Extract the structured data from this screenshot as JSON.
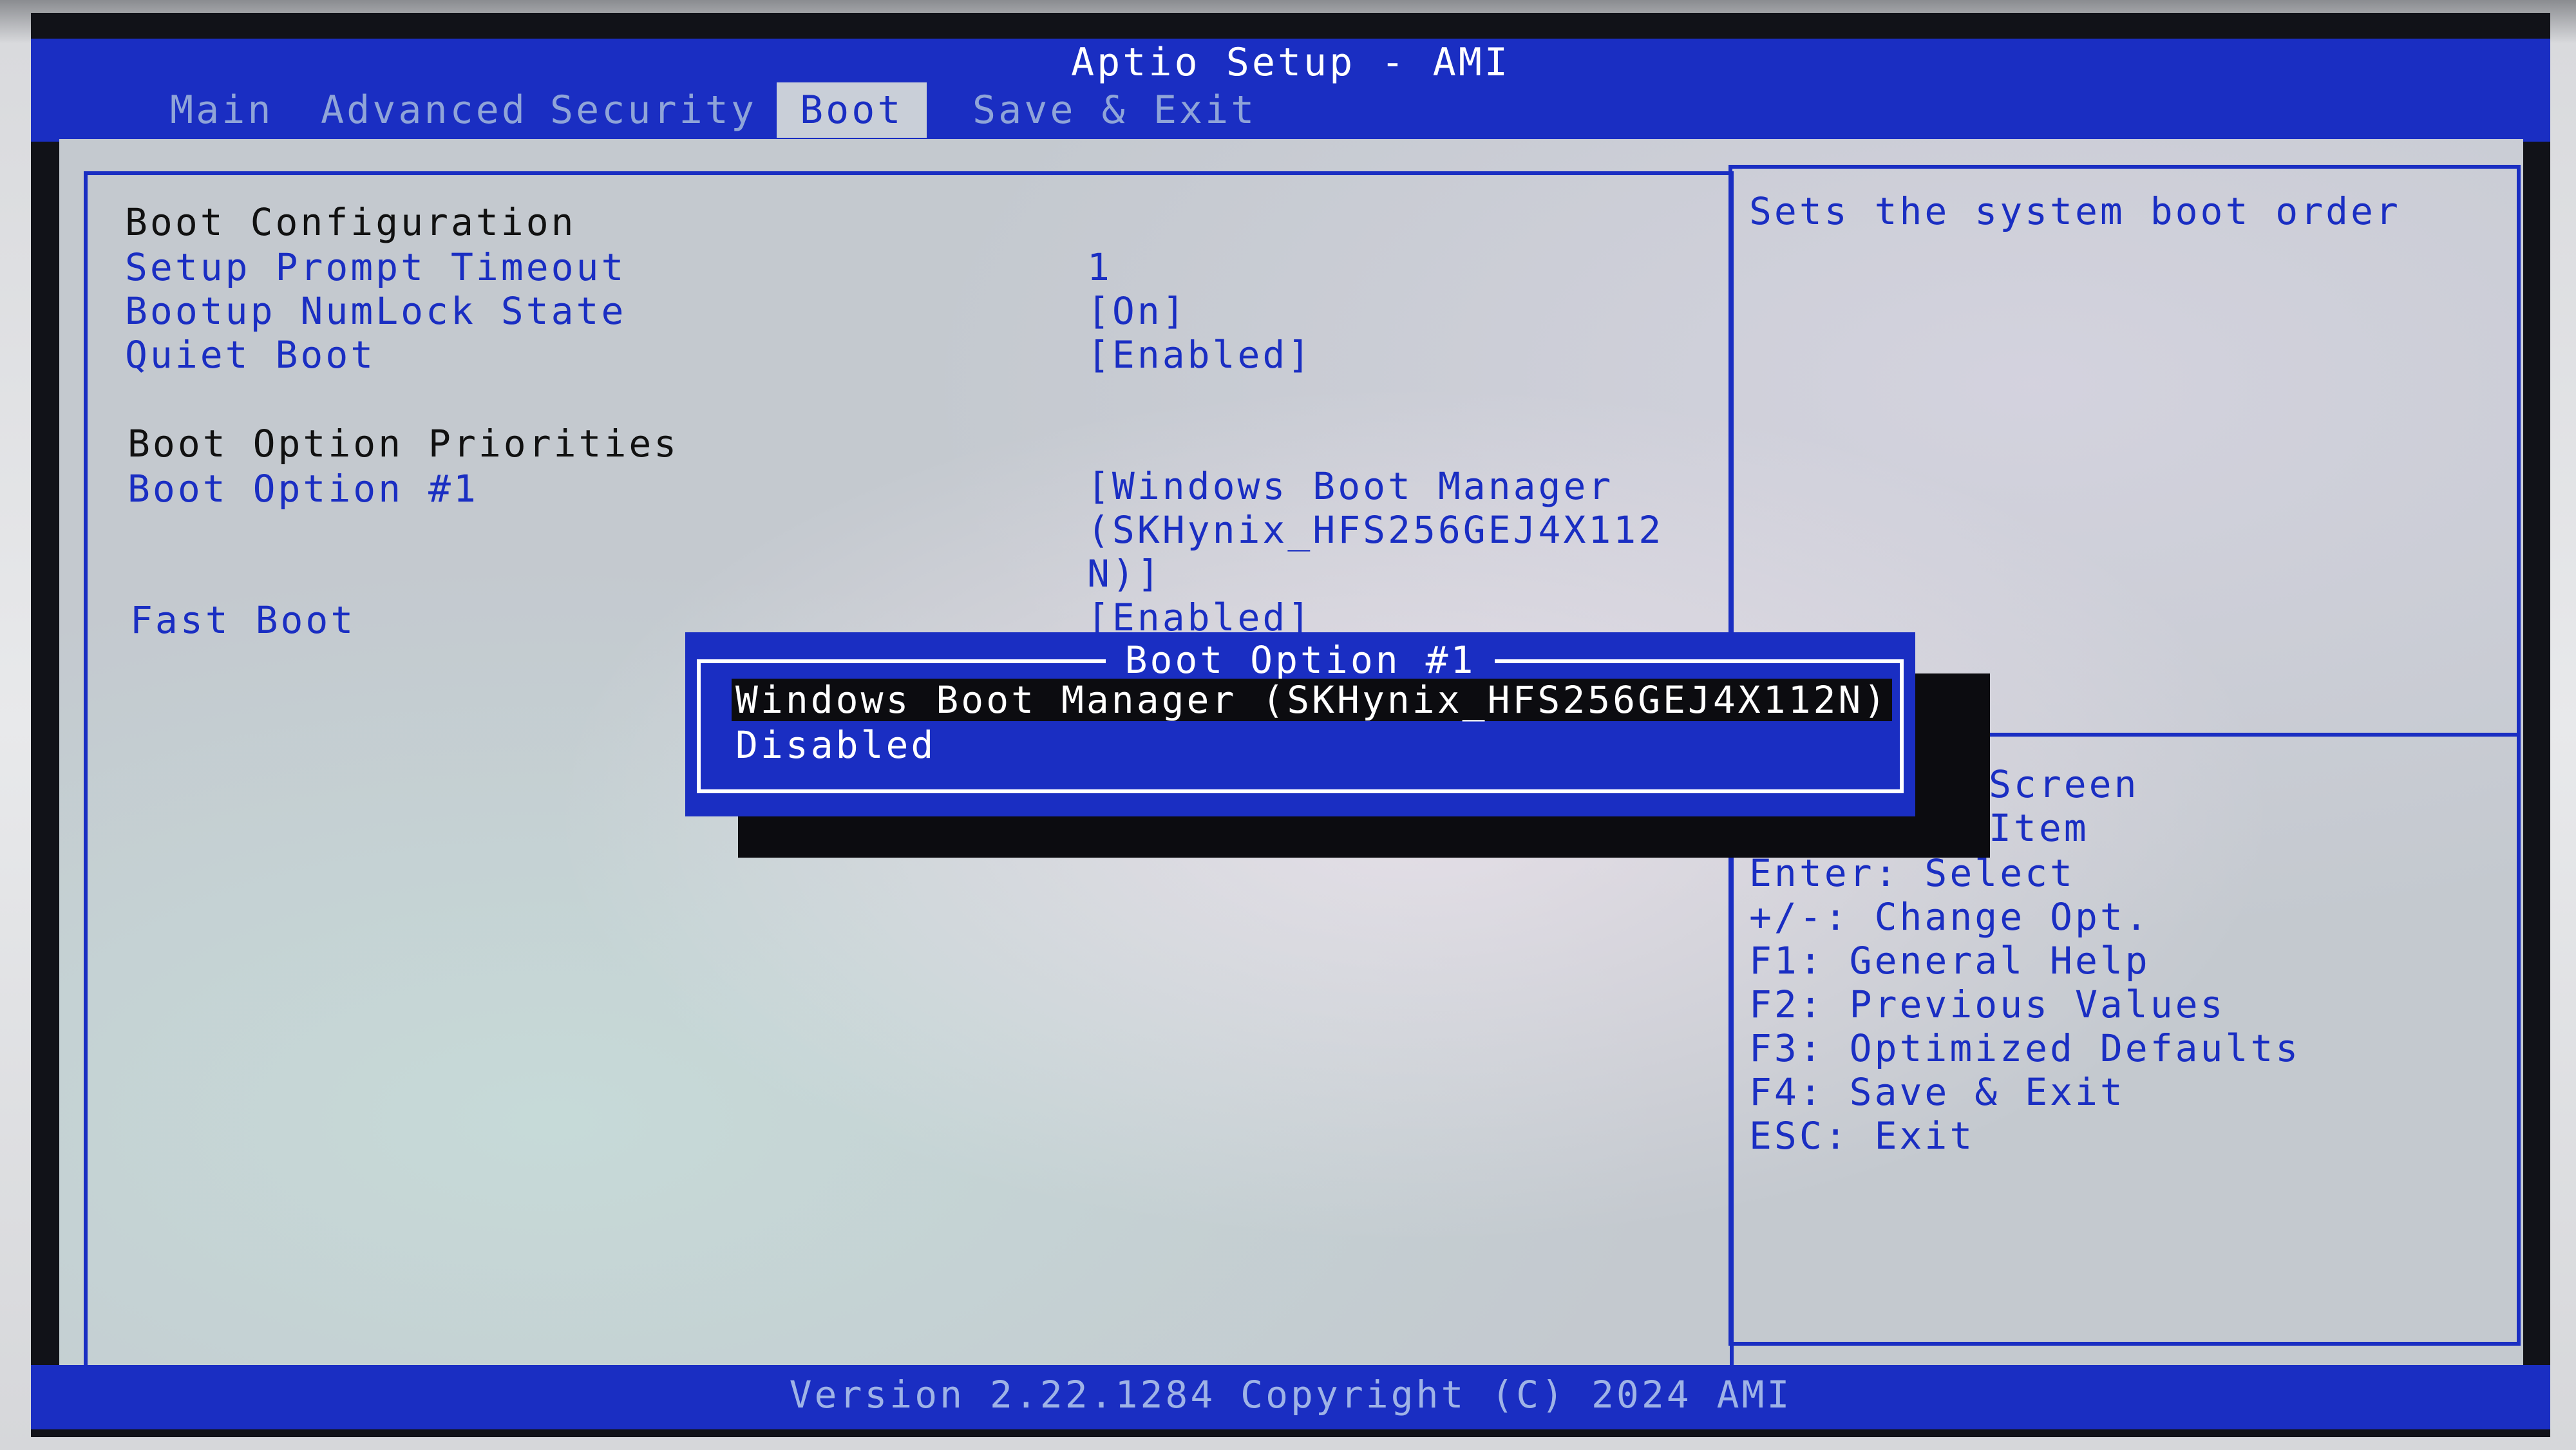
{
  "window": {
    "title": "Aptio Setup - AMI"
  },
  "tabs": [
    {
      "label": "Main",
      "active": false
    },
    {
      "label": "Advanced",
      "active": false
    },
    {
      "label": "Security",
      "active": false
    },
    {
      "label": "Boot",
      "active": true
    },
    {
      "label": "Save & Exit",
      "active": false
    }
  ],
  "settings": {
    "boot_configuration_heading": "Boot Configuration",
    "setup_prompt_timeout_label": "Setup Prompt Timeout",
    "setup_prompt_timeout_value": "1",
    "bootup_numlock_label": "Bootup NumLock State",
    "bootup_numlock_value": "[On]",
    "quiet_boot_label": "Quiet Boot",
    "quiet_boot_value": "[Enabled]",
    "boot_priorities_heading": "Boot Option Priorities",
    "boot_option_1_label": "Boot Option #1",
    "boot_option_1_value_line1": "[Windows Boot Manager",
    "boot_option_1_value_line2": "(SKHynix_HFS256GEJ4X112",
    "boot_option_1_value_line3": "N)]",
    "fast_boot_label": "Fast Boot",
    "fast_boot_value": "[Enabled]"
  },
  "help": {
    "description": "Sets the system boot order",
    "keys": [
      "Screen",
      "Item",
      "Enter: Select",
      "+/-: Change Opt.",
      "F1: General Help",
      "F2: Previous Values",
      "F3: Optimized Defaults",
      "F4: Save & Exit",
      "ESC: Exit"
    ]
  },
  "popup": {
    "title": "Boot Option #1",
    "options": [
      {
        "label": "Windows Boot Manager (SKHynix_HFS256GEJ4X112N)",
        "selected": true
      },
      {
        "label": "Disabled",
        "selected": false
      }
    ]
  },
  "footer": {
    "text": "Version 2.22.1284 Copyright (C) 2024 AMI"
  },
  "colors": {
    "accent_blue": "#1a2ec2",
    "panel_bg": "#c4c9cf",
    "highlight_bg": "#0c0c10",
    "text_white": "#ffffff"
  }
}
